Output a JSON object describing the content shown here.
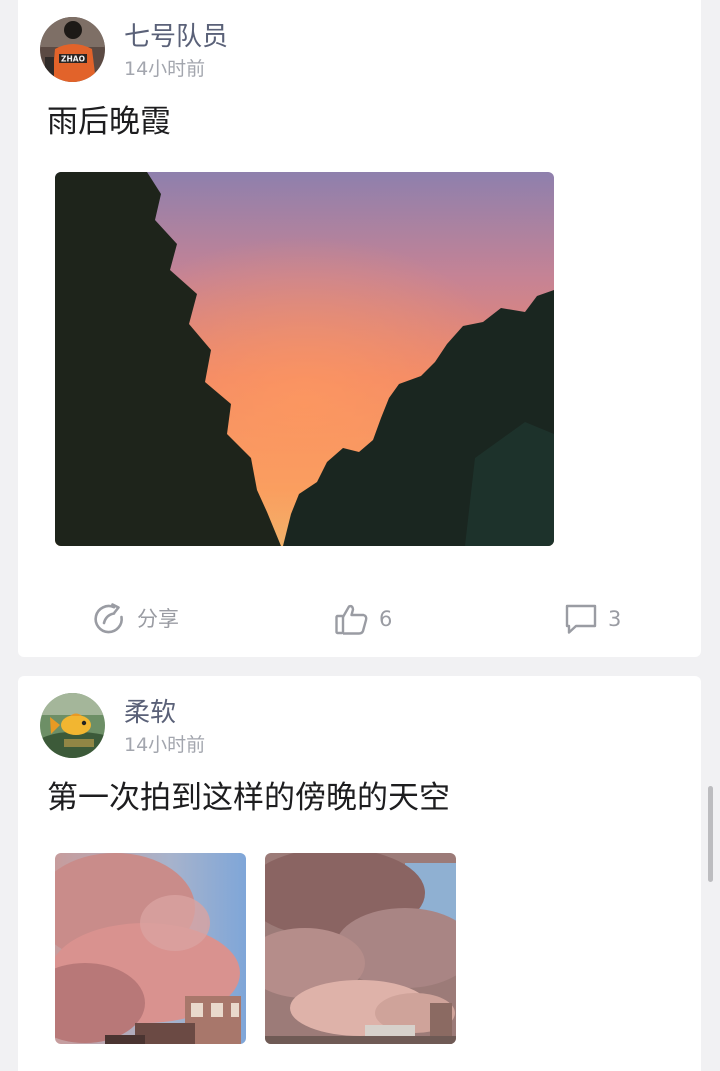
{
  "posts": [
    {
      "author": "七号队员",
      "time": "14小时前",
      "content": "雨后晚霞",
      "avatar_icon": "user-avatar-jersey",
      "image_icons": [
        "sunset-trees-photo"
      ],
      "actions": {
        "share_label": "分享",
        "like_count": "6",
        "comment_count": "3"
      }
    },
    {
      "author": "柔软",
      "time": "14小时前",
      "content": "第一次拍到这样的傍晚的天空",
      "avatar_icon": "user-avatar-fish",
      "image_icons": [
        "pink-clouds-photo",
        "pink-clouds-photo"
      ]
    }
  ],
  "colors": {
    "author": "#5a6178",
    "time": "#a3a6ae",
    "content": "#1d1d1f",
    "action": "#9a9ca3",
    "background": "#f1f1f3"
  }
}
